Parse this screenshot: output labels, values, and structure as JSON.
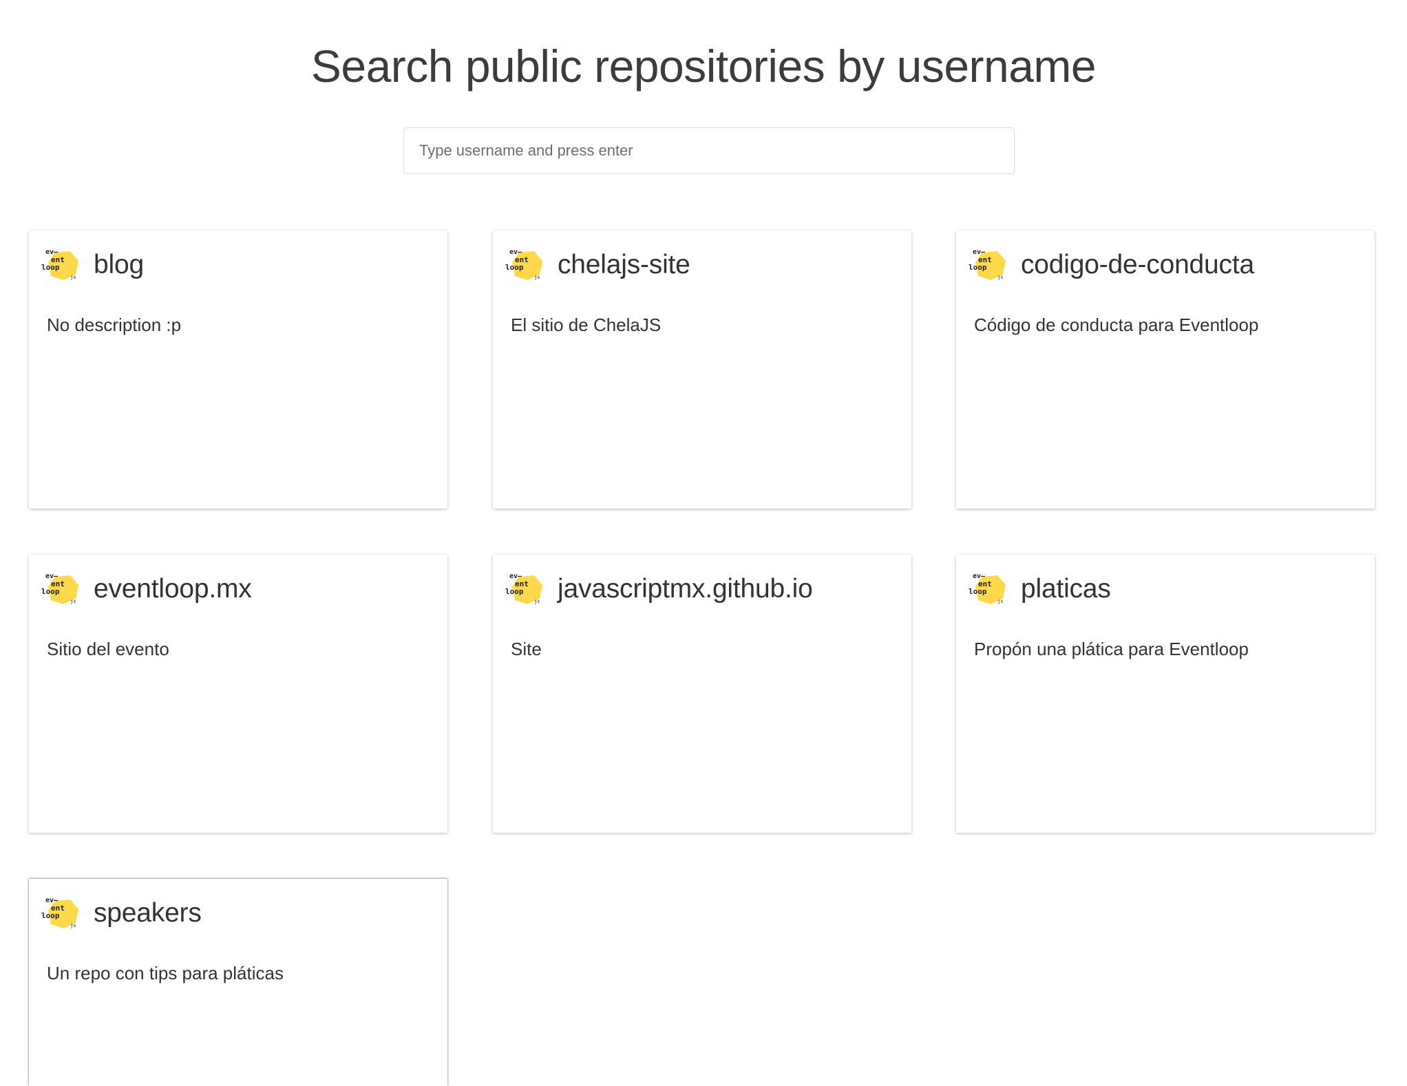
{
  "page": {
    "title": "Search public repositories by username"
  },
  "search": {
    "placeholder": "Type username and press enter",
    "value": ""
  },
  "logo": {
    "icon": "eventloop-logo-icon",
    "color": "#FFD94A",
    "line1": "ev—",
    "line2": "ent",
    "line3": "loop",
    "line4": "js"
  },
  "repos": [
    {
      "name": "blog",
      "description": "No description :p"
    },
    {
      "name": "chelajs-site",
      "description": "El sitio de ChelaJS"
    },
    {
      "name": "codigo-de-conducta",
      "description": "Código de conducta para Eventloop"
    },
    {
      "name": "eventloop.mx",
      "description": "Sitio del evento"
    },
    {
      "name": "javascriptmx.github.io",
      "description": "Site"
    },
    {
      "name": "platicas",
      "description": "Propón una plática para Eventloop"
    },
    {
      "name": "speakers",
      "description": "Un repo con tips para pláticas"
    }
  ]
}
